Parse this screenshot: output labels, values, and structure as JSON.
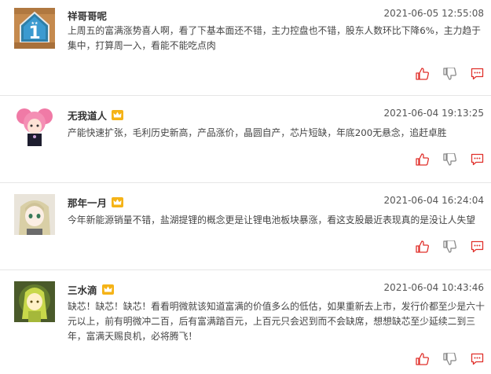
{
  "posts": [
    {
      "username": "祥哥哥呢",
      "vip": false,
      "timestamp": "2021-06-05 12:55:08",
      "content": "上周五的富满涨势喜人啊，看了下基本面还不错，主力控盘也不错，股东人数环比下降6%，主力趋于集中，打算周一入，看能不能吃点肉",
      "avatar_icon": "badge-number-1-avatar"
    },
    {
      "username": "无我道人",
      "vip": true,
      "timestamp": "2021-06-04 19:13:25",
      "content": "产能快速扩张，毛利历史新高，产品涨价，晶圆自产，芯片短缺，年底200无悬念，追赶卓胜",
      "avatar_icon": "pink-hair-girl-avatar"
    },
    {
      "username": "那年一月",
      "vip": true,
      "timestamp": "2021-06-04 16:24:04",
      "content": "今年新能源销量不错，盐湖提锂的概念更是让锂电池板块暴涨，看这支股最近表现真的是没让人失望",
      "avatar_icon": "anime-girl-avatar"
    },
    {
      "username": "三水滴",
      "vip": true,
      "timestamp": "2021-06-04 10:43:46",
      "content": "缺芯！缺芯！缺芯！看看明微就该知道富满的价值多么的低估，如果重新去上市，发行价都至少是六十元以上，前有明微冲二百，后有富满踏百元，上百元只会迟到而不会缺席，想想缺芯至少延续二到三年，富满天赐良机，必将腾飞！",
      "avatar_icon": "green-fairy-avatar"
    }
  ],
  "colors": {
    "action_red": "#e0302b",
    "crown_gold": "#f5b317"
  },
  "actions": [
    "thumbs-up-icon",
    "thumbs-down-icon",
    "comment-icon"
  ]
}
